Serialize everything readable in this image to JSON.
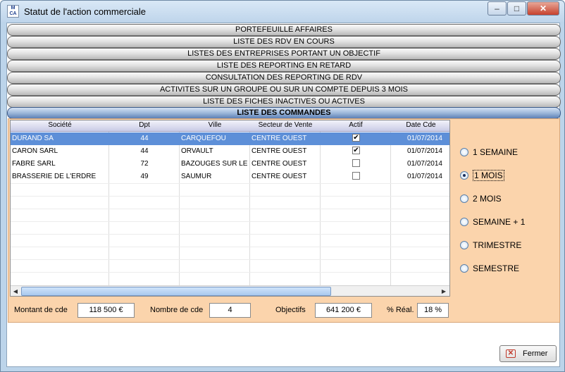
{
  "window": {
    "title": "Statut de l'action commerciale",
    "app_icon_text": "M CA",
    "minimize": "–",
    "maximize": "□",
    "close": "✕"
  },
  "tabs": [
    {
      "label": "PORTEFEUILLE AFFAIRES"
    },
    {
      "label": "LISTE DES RDV EN COURS"
    },
    {
      "label": "LISTES DES ENTREPRISES PORTANT UN OBJECTIF"
    },
    {
      "label": "LISTE DES REPORTING EN RETARD"
    },
    {
      "label": "CONSULTATION DES REPORTING DE RDV"
    },
    {
      "label": "ACTIVITES SUR UN GROUPE OU SUR UN COMPTE DEPUIS 3 MOIS"
    },
    {
      "label": "LISTE DES FICHES INACTIVES OU ACTIVES"
    },
    {
      "label": "LISTE DES COMMANDES",
      "active": true
    }
  ],
  "grid": {
    "columns": [
      "Société",
      "Dpt",
      "Ville",
      "Secteur de Vente",
      "Actif",
      "Date Cde"
    ],
    "rows": [
      {
        "societe": "DURAND SA",
        "dpt": "44",
        "ville": "CARQUEFOU",
        "secteur": "CENTRE OUEST",
        "actif": true,
        "date": "01/07/2014",
        "selected": true
      },
      {
        "societe": "CARON SARL",
        "dpt": "44",
        "ville": "ORVAULT",
        "secteur": "CENTRE OUEST",
        "actif": true,
        "date": "01/07/2014"
      },
      {
        "societe": "FABRE SARL",
        "dpt": "72",
        "ville": "BAZOUGES SUR LE L",
        "secteur": "CENTRE OUEST",
        "actif": false,
        "date": "01/07/2014"
      },
      {
        "societe": "BRASSERIE DE L'ERDRE",
        "dpt": "49",
        "ville": "SAUMUR",
        "secteur": "CENTRE OUEST",
        "actif": false,
        "date": "01/07/2014"
      }
    ],
    "scroll_left": "◀",
    "scroll_right": "▶"
  },
  "periods": [
    {
      "label": "1 SEMAINE",
      "selected": false
    },
    {
      "label": "1 MOIS",
      "selected": true
    },
    {
      "label": "2 MOIS",
      "selected": false
    },
    {
      "label": "SEMAINE + 1",
      "selected": false
    },
    {
      "label": "TRIMESTRE",
      "selected": false
    },
    {
      "label": "SEMESTRE",
      "selected": false
    }
  ],
  "footer": {
    "montant_label": "Montant de cde",
    "montant_value": "118 500 €",
    "nombre_label": "Nombre de cde",
    "nombre_value": "4",
    "objectifs_label": "Objectifs",
    "objectifs_value": "641 200 €",
    "real_label": "% Réal.",
    "real_value": "18 %"
  },
  "close_button": {
    "label": "Fermer",
    "icon": "✕"
  },
  "colors": {
    "panel": "#fbd4ac",
    "selected_row": "#5d8fd8",
    "active_tab": "#5c7fb4"
  }
}
